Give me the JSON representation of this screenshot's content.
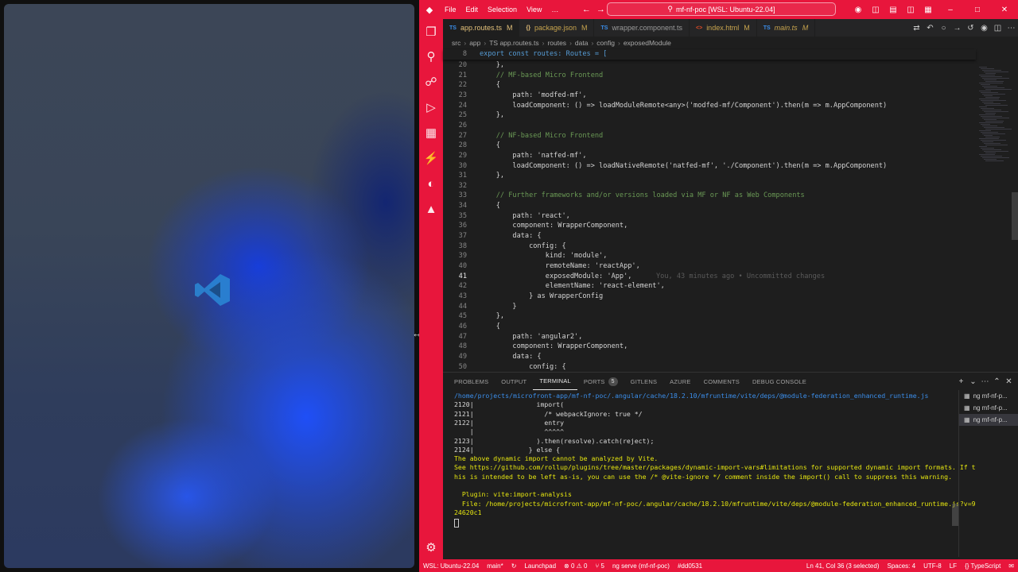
{
  "titlebar": {
    "menu": [
      "File",
      "Edit",
      "Selection",
      "View",
      "…"
    ],
    "search_text": "mf-nf-poc [WSL: Ubuntu-22.04]"
  },
  "tabs": [
    {
      "icon": "TS",
      "label": "app.routes.ts",
      "modified": "M",
      "active": true
    },
    {
      "icon": "{}",
      "label": "package.json",
      "modified": "M",
      "active": false
    },
    {
      "icon": "TS",
      "label": "wrapper.component.ts",
      "modified": "",
      "active": false
    },
    {
      "icon": "<>",
      "label": "index.html",
      "modified": "M",
      "active": false
    },
    {
      "icon": "TS",
      "label": "main.ts",
      "modified": "M",
      "active": false
    }
  ],
  "breadcrumb": [
    "src",
    "app",
    "TS app.routes.ts",
    "routes",
    "data",
    "config",
    "exposedModule"
  ],
  "sticky": {
    "line": "8",
    "text": "export const routes: Routes = ["
  },
  "code": {
    "current_line": "41",
    "blame": "You, 43 minutes ago • Uncommitted changes",
    "lines": [
      {
        "n": "20",
        "t": "    },"
      },
      {
        "n": "21",
        "t": "    // MF-based Micro Frontend"
      },
      {
        "n": "22",
        "t": "    {"
      },
      {
        "n": "23",
        "t": "        path: 'modfed-mf',"
      },
      {
        "n": "24",
        "t": "        loadComponent: () => loadModuleRemote<any>('modfed-mf/Component').then(m => m.AppComponent)"
      },
      {
        "n": "25",
        "t": "    },"
      },
      {
        "n": "26",
        "t": ""
      },
      {
        "n": "27",
        "t": "    // NF-based Micro Frontend"
      },
      {
        "n": "28",
        "t": "    {"
      },
      {
        "n": "29",
        "t": "        path: 'natfed-mf',"
      },
      {
        "n": "30",
        "t": "        loadComponent: () => loadNativeRemote('natfed-mf', './Component').then(m => m.AppComponent)"
      },
      {
        "n": "31",
        "t": "    },"
      },
      {
        "n": "32",
        "t": ""
      },
      {
        "n": "33",
        "t": "    // Further frameworks and/or versions loaded via MF or NF as Web Components"
      },
      {
        "n": "34",
        "t": "    {"
      },
      {
        "n": "35",
        "t": "        path: 'react',"
      },
      {
        "n": "36",
        "t": "        component: WrapperComponent,"
      },
      {
        "n": "37",
        "t": "        data: {"
      },
      {
        "n": "38",
        "t": "            config: {"
      },
      {
        "n": "39",
        "t": "                kind: 'module',"
      },
      {
        "n": "40",
        "t": "                remoteName: 'reactApp',"
      },
      {
        "n": "41",
        "t": "                exposedModule: 'App',"
      },
      {
        "n": "42",
        "t": "                elementName: 'react-element',"
      },
      {
        "n": "43",
        "t": "            } as WrapperConfig"
      },
      {
        "n": "44",
        "t": "        }"
      },
      {
        "n": "45",
        "t": "    },"
      },
      {
        "n": "46",
        "t": "    {"
      },
      {
        "n": "47",
        "t": "        path: 'angular2',"
      },
      {
        "n": "48",
        "t": "        component: WrapperComponent,"
      },
      {
        "n": "49",
        "t": "        data: {"
      },
      {
        "n": "50",
        "t": "            config: {"
      }
    ]
  },
  "panel": {
    "tabs": [
      {
        "label": "PROBLEMS",
        "active": false,
        "badge": ""
      },
      {
        "label": "OUTPUT",
        "active": false,
        "badge": ""
      },
      {
        "label": "TERMINAL",
        "active": true,
        "badge": ""
      },
      {
        "label": "PORTS",
        "active": false,
        "badge": "5"
      },
      {
        "label": "GITLENS",
        "active": false,
        "badge": ""
      },
      {
        "label": "AZURE",
        "active": false,
        "badge": ""
      },
      {
        "label": "COMMENTS",
        "active": false,
        "badge": ""
      },
      {
        "label": "DEBUG CONSOLE",
        "active": false,
        "badge": ""
      }
    ],
    "terminal_lines": [
      {
        "t": "/home/projects/microfront-app/mf-nf-poc/.angular/cache/18.2.10/mfruntime/vite/deps/@module-federation_enhanced_runtime.js",
        "cls": "link"
      },
      {
        "t": "2120|                import(",
        "cls": ""
      },
      {
        "t": "2121|                  /* webpackIgnore: true */",
        "cls": ""
      },
      {
        "t": "2122|                  entry",
        "cls": ""
      },
      {
        "t": "    |                  ^^^^^",
        "cls": ""
      },
      {
        "t": "2123|                ).then(resolve).catch(reject);",
        "cls": ""
      },
      {
        "t": "2124|              } else {",
        "cls": ""
      },
      {
        "t": "The above dynamic import cannot be analyzed by Vite.",
        "cls": "y"
      },
      {
        "t": "See https://github.com/rollup/plugins/tree/master/packages/dynamic-import-vars#limitations for supported dynamic import formats. If t",
        "cls": "y"
      },
      {
        "t": "his is intended to be left as-is, you can use the /* @vite-ignore */ comment inside the import() call to suppress this warning.",
        "cls": "y"
      },
      {
        "t": "",
        "cls": ""
      },
      {
        "t": "  Plugin: vite:import-analysis",
        "cls": "y"
      },
      {
        "t": "  File: /home/projects/microfront-app/mf-nf-poc/.angular/cache/18.2.10/mfruntime/vite/deps/@module-federation_enhanced_runtime.js?v=9",
        "cls": "y"
      },
      {
        "t": "24620c1",
        "cls": "y"
      }
    ],
    "terminals": [
      "ng  mf-nf-p...",
      "ng  mf-nf-p...",
      "ng  mf-nf-p..."
    ]
  },
  "statusbar": {
    "remote": "WSL: Ubuntu-22.04",
    "branch": "main*",
    "launchpad": "Launchpad",
    "problems": "⊗ 0 ⚠ 0",
    "ports": "⑂ 5",
    "task": "ng serve (mf-nf-poc)",
    "commit": "#dd0531",
    "position": "Ln 41, Col 36 (3 selected)",
    "spaces": "Spaces: 4",
    "encoding": "UTF-8",
    "eol": "LF",
    "language": "{} TypeScript"
  },
  "colors": {
    "accent": "#e8163c",
    "editor_bg": "#1e1e1e"
  }
}
